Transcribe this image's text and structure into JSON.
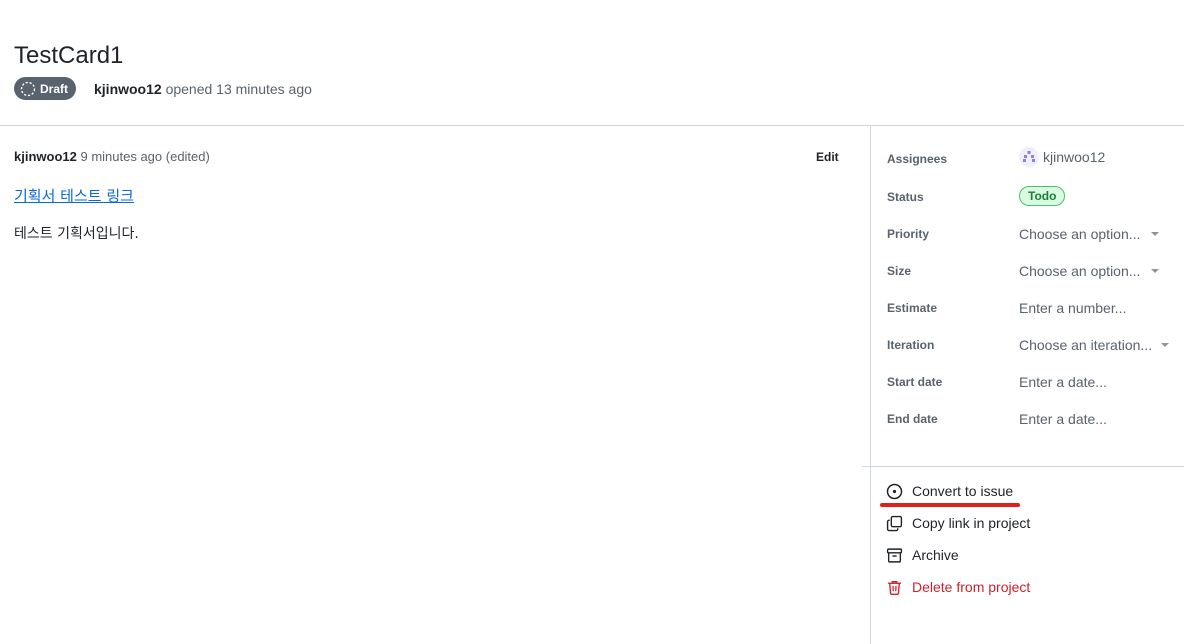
{
  "header": {
    "title": "TestCard1",
    "badge": "Draft",
    "author": "kjinwoo12",
    "opened_text": " opened 13 minutes ago"
  },
  "comment": {
    "author": "kjinwoo12",
    "time": "9 minutes ago (edited)",
    "edit_label": "Edit",
    "link_text": "기획서 테스트 링크",
    "body_text": "테스트 기획서입니다."
  },
  "sidebar": {
    "fields": {
      "assignees": {
        "label": "Assignees",
        "value": "kjinwoo12"
      },
      "status": {
        "label": "Status",
        "value": "Todo"
      },
      "priority": {
        "label": "Priority",
        "value": "Choose an option..."
      },
      "size": {
        "label": "Size",
        "value": "Choose an option..."
      },
      "estimate": {
        "label": "Estimate",
        "value": "Enter a number..."
      },
      "iteration": {
        "label": "Iteration",
        "value": "Choose an iteration..."
      },
      "start_date": {
        "label": "Start date",
        "value": "Enter a date..."
      },
      "end_date": {
        "label": "End date",
        "value": "Enter a date..."
      }
    },
    "actions": {
      "convert": "Convert to issue",
      "copy_link": "Copy link in project",
      "archive": "Archive",
      "delete": "Delete from project"
    }
  },
  "colors": {
    "link": "#0969da",
    "danger": "#cf222e",
    "status_green": "#1a7f37",
    "draft_badge": "#59636e",
    "highlight_underline": "#e0201c"
  },
  "icons": [
    "draft-circle-icon",
    "dropdown-caret-icon",
    "issue-opened-icon",
    "copy-icon",
    "archive-icon",
    "trash-icon"
  ]
}
